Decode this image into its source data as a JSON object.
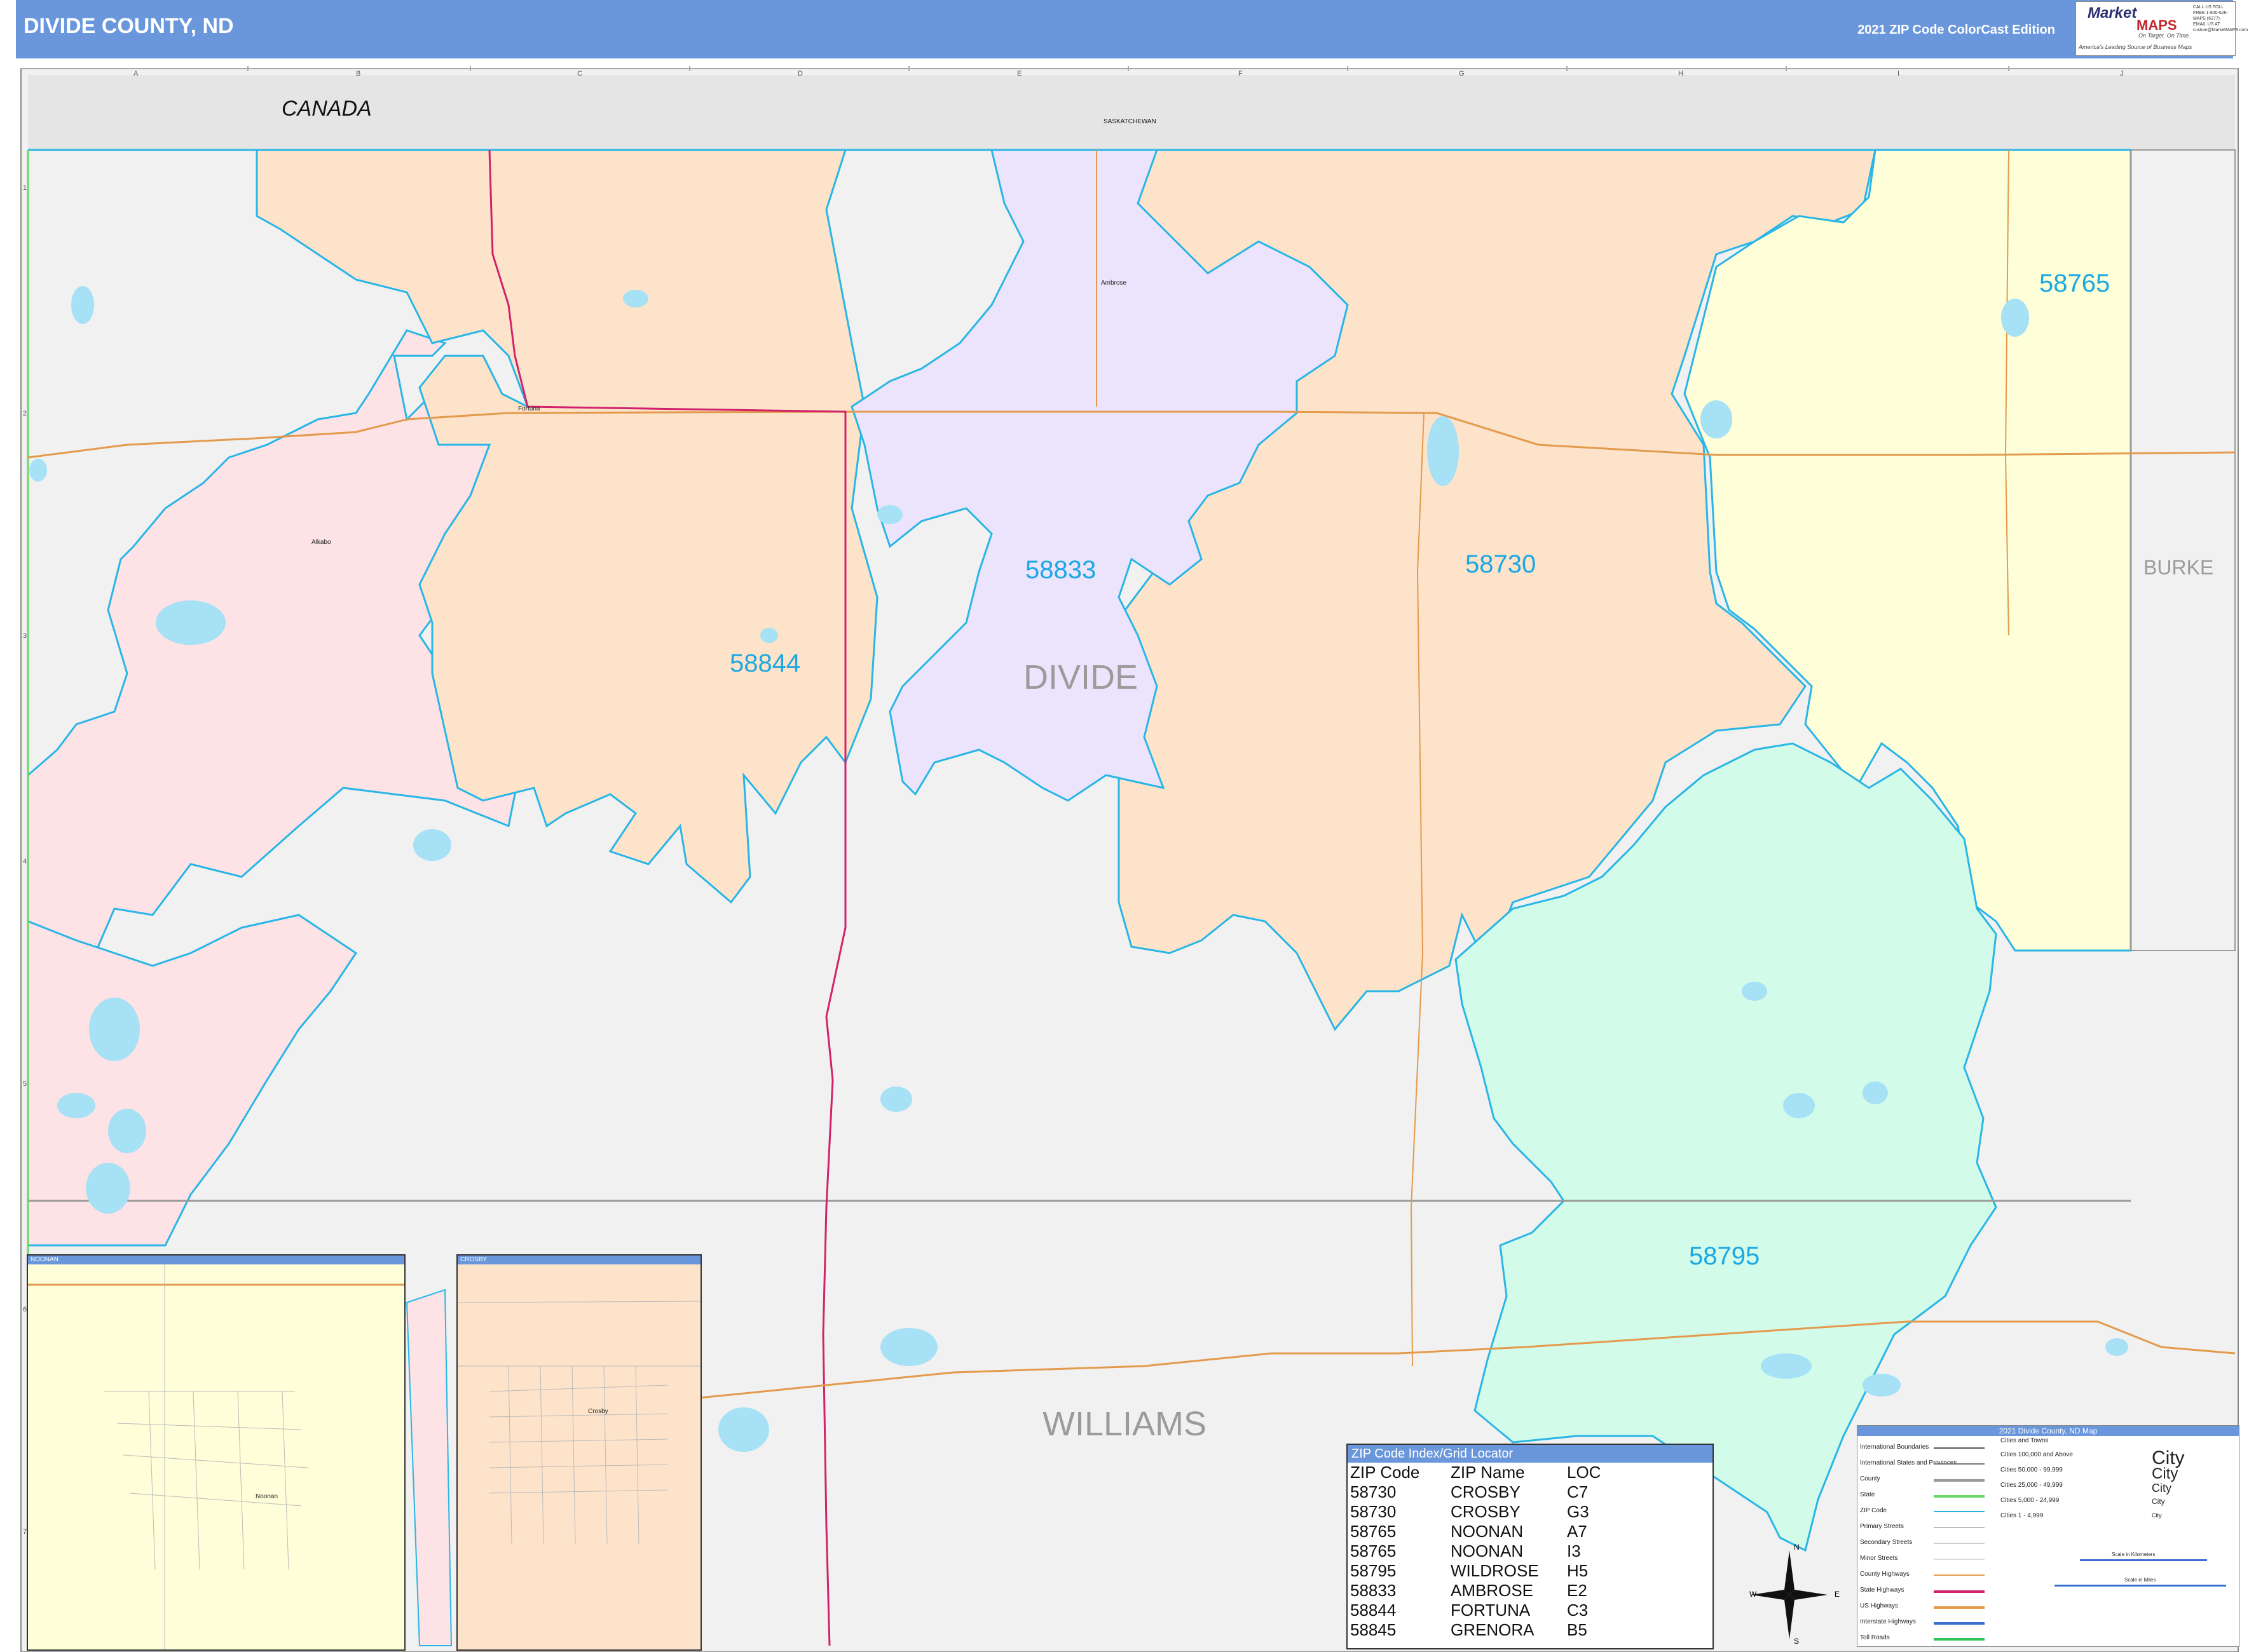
{
  "header": {
    "title": "DIVIDE COUNTY, ND",
    "edition": "2021 ZIP Code ColorCast Edition"
  },
  "logo": {
    "brand_word1": "Market",
    "brand_word2": "MAPS",
    "tagline1": "On Target. On Time.",
    "tagline2": "America's Leading Source of Business Maps",
    "contact": "CALL US TOLL FREE 1-800-626-MAPS (6277) EMAIL US AT: custom@MarketMAPS.com"
  },
  "map": {
    "country_label": "CANADA",
    "province_label": "SASKATCHEWAN",
    "county_labels": {
      "divide": "DIVIDE",
      "williams": "WILLIAMS",
      "burke": "BURKE"
    },
    "zip_labels": [
      "58844",
      "58833",
      "58730",
      "58765",
      "58795"
    ],
    "towns": [
      "Fortuna",
      "Ambrose",
      "Alkabo",
      "Noonan",
      "Crosby"
    ],
    "grid_columns": [
      "A",
      "B",
      "C",
      "D",
      "E",
      "F",
      "G",
      "H",
      "I",
      "J"
    ],
    "grid_rows": [
      "1",
      "2",
      "3",
      "4",
      "5",
      "6",
      "7"
    ],
    "colors": {
      "zip_58844": "#fde3ca",
      "zip_58730": "#fde3ca",
      "zip_58833": "#ebe4fc",
      "zip_58765": "#fefed8",
      "zip_58795": "#d2fbe9",
      "zip_58845": "#fde2e6",
      "outside": "#f1f1f1",
      "canada": "#e5e5e5",
      "zip_boundary": "#29b6e6",
      "water": "#a6e1f5",
      "state_hwy": "#d0236b",
      "us_hwy": "#e39a4c"
    }
  },
  "insets": {
    "noonan": {
      "title": "NOONAN",
      "town": "Noonan"
    },
    "crosby": {
      "title": "CROSBY",
      "town": "Crosby"
    }
  },
  "zip_index": {
    "title": "ZIP Code Index/Grid Locator",
    "headers": [
      "ZIP Code",
      "ZIP Name",
      "LOC"
    ],
    "rows": [
      [
        "58730",
        "CROSBY",
        "C7"
      ],
      [
        "58730",
        "CROSBY",
        "G3"
      ],
      [
        "58765",
        "NOONAN",
        "A7"
      ],
      [
        "58765",
        "NOONAN",
        "I3"
      ],
      [
        "58795",
        "WILDROSE",
        "H5"
      ],
      [
        "58833",
        "AMBROSE",
        "E2"
      ],
      [
        "58844",
        "FORTUNA",
        "C3"
      ],
      [
        "58845",
        "GRENORA",
        "B5"
      ]
    ]
  },
  "legend": {
    "title": "2021 Divide County, ND Map",
    "items": [
      "International Boundaries",
      "International States and Provinces",
      "County",
      "State",
      "ZIP Code",
      "Primary Streets",
      "Secondary Streets",
      "Minor Streets",
      "County Highways",
      "State Highways",
      "US Highways",
      "Interstate Highways",
      "Toll Roads"
    ],
    "cities_header": "Cities and Towns",
    "city_sizes": [
      [
        "Cities 100,000 and Above",
        "City"
      ],
      [
        "Cities 50,000 - 99,999",
        "City"
      ],
      [
        "Cities 25,000 - 49,999",
        "City"
      ],
      [
        "Cities 5,000 - 24,999",
        "City"
      ],
      [
        "Cities 1 - 4,999",
        "City"
      ]
    ],
    "scale_km": "Scale in Kilometers",
    "scale_mi": "Scale in Miles"
  },
  "compass": {
    "n": "N",
    "s": "S",
    "e": "E",
    "w": "W"
  }
}
